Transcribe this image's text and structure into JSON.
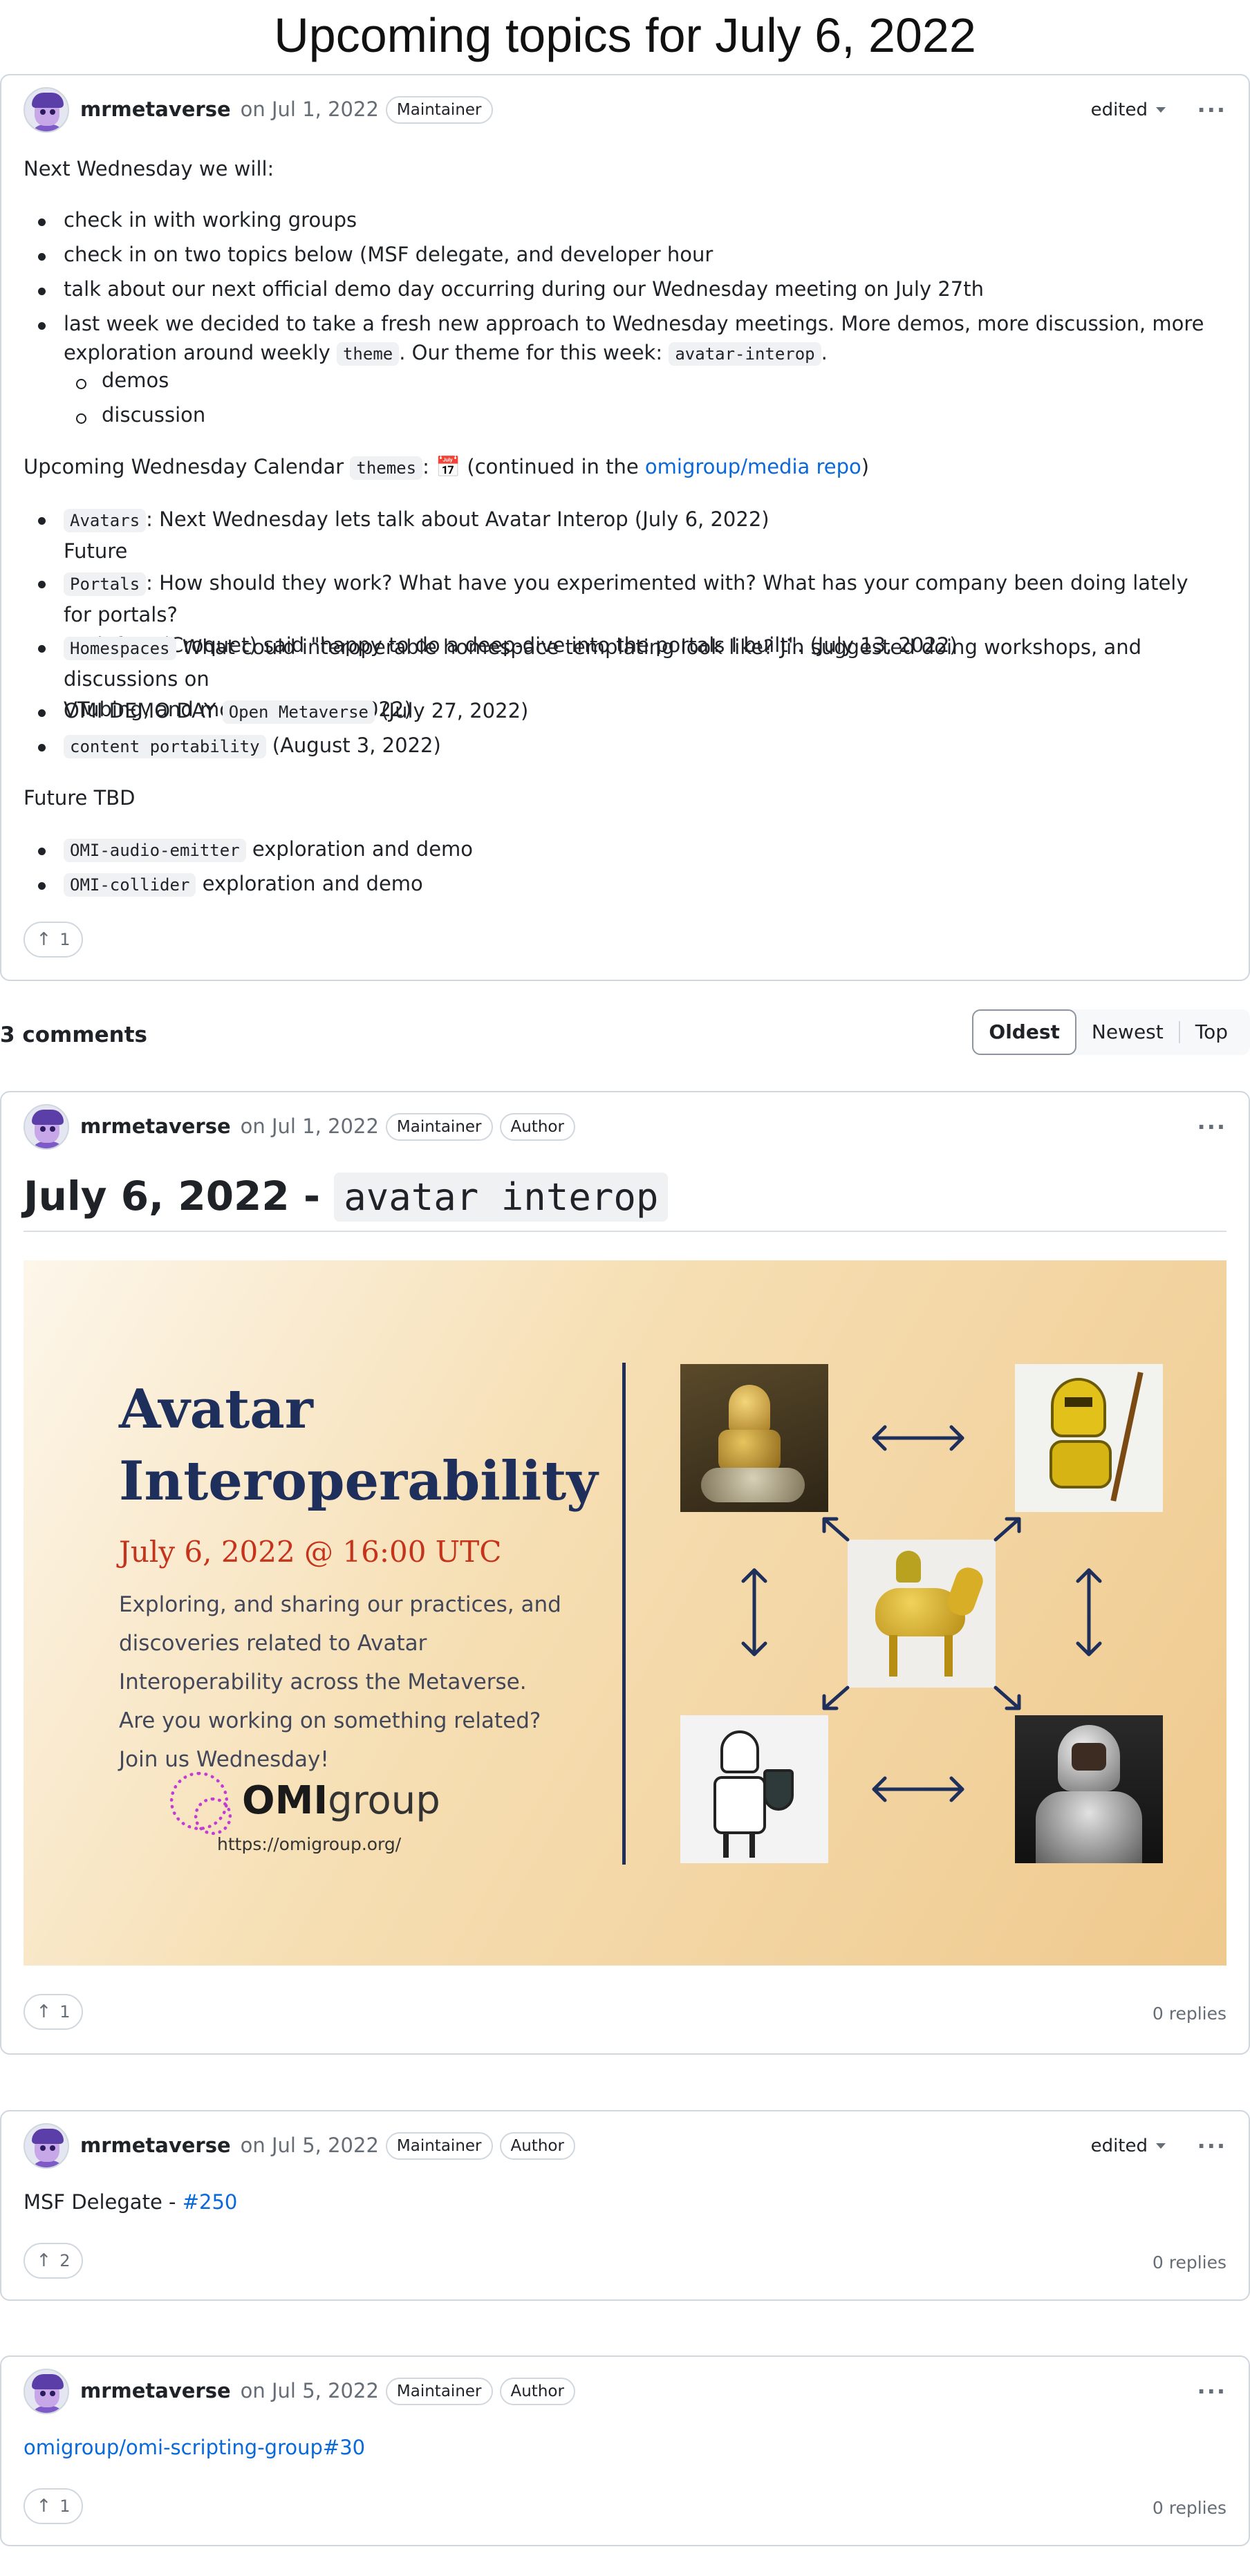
{
  "page_title": "Upcoming topics for July 6, 2022",
  "post": {
    "author": "mrmetaverse",
    "date": "on Jul 1, 2022",
    "badge": "Maintainer",
    "edited": "edited",
    "intro": "Next Wednesday we will:",
    "bullets": {
      "b1": "check in with working groups",
      "b2": "check in on two topics below (MSF delegate, and developer hour",
      "b3": "talk about our next official demo day occurring during our Wednesday meeting on July 27th",
      "b4_a": "last week we decided to take a fresh new approach to Wednesday meetings. More demos, more discussion, more exploration around weekly ",
      "b4_code1": "theme",
      "b4_b": ". Our theme for this week: ",
      "b4_code2": "avatar-interop",
      "b4_c": ".",
      "sub1": "demos",
      "sub2": "discussion"
    },
    "calendar_a": "Upcoming Wednesday Calendar ",
    "calendar_code": "themes",
    "calendar_b": ": ",
    "calendar_emoji": "📅",
    "calendar_c": " (continued in the ",
    "calendar_link": "omigroup/media repo",
    "calendar_d": ")",
    "cal": {
      "c1_code": "Avatars",
      "c1_text": ": Next Wednesday lets talk about Avatar Interop (July 6, 2022)",
      "c1_sub": "Future",
      "c2_code": "Portals",
      "c2_text": ": How should they work? What have you experimented with? What has your company been doing lately for portals?",
      "c2_text2": "Codefrau (Croquet) said \"happy to do a deep-dive into the portals I built\". (July 13, 2022)",
      "c3_code": "Homespaces",
      "c3_text": " What could interoperable homespace templating look like? Jin suggested doing workshops, and discussions on",
      "c3_text2": "VTubing, and more. (July 20, 2022)",
      "c4_text": "OMI DEMO DAY ",
      "c4_code": "Open Metaverse",
      "c4_text2": " (July 27, 2022)",
      "c5_code": "content portability",
      "c5_text": " (August 3, 2022)"
    },
    "future_tbd": "Future TBD",
    "tbd": {
      "t1_code": "OMI-audio-emitter",
      "t1_text": " exploration and demo",
      "t2_code": "OMI-collider",
      "t2_text": " exploration and demo"
    },
    "upvotes": "1"
  },
  "comments_header": {
    "count": "3 comments",
    "sort": [
      "Oldest",
      "Newest",
      "Top"
    ]
  },
  "comments": [
    {
      "author": "mrmetaverse",
      "date": "on Jul 1, 2022",
      "badges": [
        "Maintainer",
        "Author"
      ],
      "heading_text": "July 6, 2022 - ",
      "heading_code": "avatar interop",
      "banner": {
        "title_line1": "Avatar",
        "title_line2": "Interoperability",
        "date": "July 6, 2022 @ 16:00 UTC",
        "desc": "Exploring, and sharing our practices, and discoveries related to Avatar Interoperability across the Metaverse. Are you working on something related? Join us Wednesday!",
        "logo_bold": "OMI",
        "logo_light": "group",
        "url": "https://omigroup.org/"
      },
      "upvotes": "1",
      "replies": "0 replies"
    },
    {
      "author": "mrmetaverse",
      "date": "on Jul 5, 2022",
      "badges": [
        "Maintainer",
        "Author"
      ],
      "edited": "edited",
      "text": "MSF Delegate - ",
      "link": "#250",
      "upvotes": "2",
      "replies": "0 replies"
    },
    {
      "author": "mrmetaverse",
      "date": "on Jul 5, 2022",
      "badges": [
        "Maintainer",
        "Author"
      ],
      "link": "omigroup/omi-scripting-group#30",
      "upvotes": "1",
      "replies": "0 replies"
    }
  ],
  "colors": {
    "link": "#0969da",
    "border": "#d0d7de",
    "banner_title": "#1e2f5c",
    "banner_date": "#c6331b",
    "logo_accent": "#c23bd4"
  }
}
